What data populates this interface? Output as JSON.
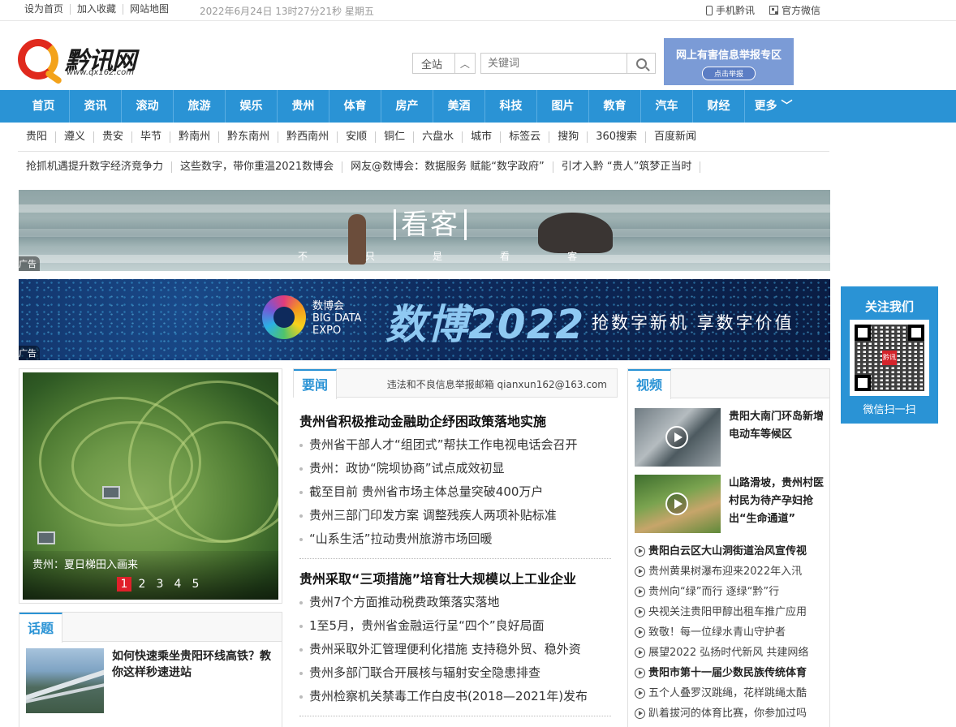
{
  "topbar": {
    "links": [
      "设为首页",
      "加入收藏",
      "网站地图"
    ],
    "datetime": "2022年6月24日 13时27分21秒 星期五",
    "mobile": "手机黔讯",
    "wechat": "官方微信"
  },
  "logo": {
    "name": "黔讯网",
    "url": "www.qx162.com"
  },
  "search": {
    "scope": "全站",
    "placeholder": "关键词"
  },
  "report": {
    "title": "网上有害信息举报专区",
    "button": "点击举报"
  },
  "nav": [
    "首页",
    "资讯",
    "滚动",
    "旅游",
    "娱乐",
    "贵州",
    "体育",
    "房产",
    "美酒",
    "科技",
    "图片",
    "教育",
    "汽车",
    "财经",
    "更多"
  ],
  "cities": [
    "贵阳",
    "遵义",
    "贵安",
    "毕节",
    "黔南州",
    "黔东南州",
    "黔西南州",
    "安顺",
    "铜仁",
    "六盘水",
    "城市",
    "标签云",
    "搜狗",
    "360搜索",
    "百度新闻"
  ],
  "headlines": [
    "抢抓机遇提升数字经济竞争力",
    "这些数字，带你重温2021数博会",
    "网友@数博会：数据服务 赋能“数字政府”",
    "引才入黔 “贵人”筑梦正当时"
  ],
  "banner1": {
    "brand": "看客",
    "slogan": [
      "不",
      "只",
      "是",
      "看",
      "客"
    ],
    "ad": "广告"
  },
  "banner2": {
    "expo_cn": "数博会",
    "expo_en1": "BIG DATA",
    "expo_en2": "EXPO",
    "title": "数博2022",
    "motto": "抢数字新机 享数字价值",
    "ad": "广告"
  },
  "follow": {
    "title": "关注我们",
    "qr_center": "黔讯",
    "scan": "微信扫一扫"
  },
  "photo": {
    "caption": "贵州：夏日梯田入画来",
    "pages": [
      "1",
      "2",
      "3",
      "4",
      "5"
    ],
    "active_page": 1
  },
  "topic": {
    "tab": "话题",
    "title": "如何快速乘坐贵阳环线高铁？教你这样秒速进站"
  },
  "news": {
    "tab": "要闻",
    "mail": "违法和不良信息举报邮箱 qianxun162@163.com",
    "group1": {
      "headline": "贵州省积极推动金融助企纾困政策落地实施",
      "items": [
        "贵州省干部人才“组团式”帮扶工作电视电话会召开",
        "贵州：政协“院坝协商”试点成效初显",
        "截至目前 贵州省市场主体总量突破400万户",
        "贵州三部门印发方案 调整残疾人两项补贴标准",
        "“山系生活”拉动贵州旅游市场回暖"
      ]
    },
    "group2": {
      "headline": "贵州采取“三项措施”培育壮大规模以上工业企业",
      "items": [
        "贵州7个方面推动税费政策落实落地",
        "1至5月，贵州省金融运行呈“四个”良好局面",
        "贵州采取外汇管理便利化措施 支持稳外贸、稳外资",
        "贵州多部门联合开展核与辐射安全隐患排查",
        "贵州检察机关禁毒工作白皮书(2018—2021年)发布"
      ]
    }
  },
  "video": {
    "tab": "视频",
    "feature1": "贵阳大南门环岛新增电动车等候区",
    "feature2": "山路滑坡，贵州村医村民为待产孕妇抢出“生命通道”",
    "items": [
      {
        "text": "贵阳白云区大山洞街道治风宣传视",
        "bold": true
      },
      {
        "text": "贵州黄果树瀑布迎来2022年入汛",
        "bold": false
      },
      {
        "text": "贵州向“绿”而行 逐绿“黔”行",
        "bold": false
      },
      {
        "text": "央视关注贵阳甲醇出租车推广应用",
        "bold": false
      },
      {
        "text": "致敬！每一位绿水青山守护者",
        "bold": false
      },
      {
        "text": "展望2022 弘扬时代新风 共建网络",
        "bold": false
      },
      {
        "text": "贵阳市第十一届少数民族传统体育",
        "bold": true
      },
      {
        "text": "五个人叠罗汉跳绳，花样跳绳太酷",
        "bold": false
      },
      {
        "text": "趴着拔河的体育比赛，你参加过吗",
        "bold": false
      }
    ]
  }
}
